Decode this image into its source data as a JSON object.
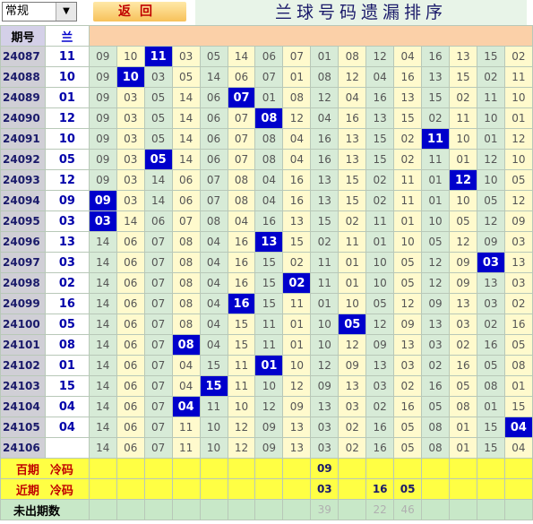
{
  "toolbar": {
    "select_value": "常规",
    "back_label": "返回",
    "title": "兰球号码遗漏排序"
  },
  "header": {
    "issue_label": "期号",
    "blue_label": "兰"
  },
  "rows": [
    {
      "issue": "24087",
      "blue": "11",
      "hit": 2,
      "cells": [
        "09",
        "10",
        "11",
        "03",
        "05",
        "14",
        "06",
        "07",
        "01",
        "08",
        "12",
        "04",
        "16",
        "13",
        "15",
        "02"
      ]
    },
    {
      "issue": "24088",
      "blue": "10",
      "hit": 1,
      "cells": [
        "09",
        "10",
        "03",
        "05",
        "14",
        "06",
        "07",
        "01",
        "08",
        "12",
        "04",
        "16",
        "13",
        "15",
        "02",
        "11"
      ]
    },
    {
      "issue": "24089",
      "blue": "01",
      "hit": 5,
      "cells": [
        "09",
        "03",
        "05",
        "14",
        "06",
        "07",
        "01",
        "08",
        "12",
        "04",
        "16",
        "13",
        "15",
        "02",
        "11",
        "10"
      ]
    },
    {
      "issue": "24090",
      "blue": "12",
      "hit": 6,
      "cells": [
        "09",
        "03",
        "05",
        "14",
        "06",
        "07",
        "08",
        "12",
        "04",
        "16",
        "13",
        "15",
        "02",
        "11",
        "10",
        "01"
      ]
    },
    {
      "issue": "24091",
      "blue": "10",
      "hit": 12,
      "cells": [
        "09",
        "03",
        "05",
        "14",
        "06",
        "07",
        "08",
        "04",
        "16",
        "13",
        "15",
        "02",
        "11",
        "10",
        "01",
        "12"
      ]
    },
    {
      "issue": "24092",
      "blue": "05",
      "hit": 2,
      "cells": [
        "09",
        "03",
        "05",
        "14",
        "06",
        "07",
        "08",
        "04",
        "16",
        "13",
        "15",
        "02",
        "11",
        "01",
        "12",
        "10"
      ]
    },
    {
      "issue": "24093",
      "blue": "12",
      "hit": 13,
      "cells": [
        "09",
        "03",
        "14",
        "06",
        "07",
        "08",
        "04",
        "16",
        "13",
        "15",
        "02",
        "11",
        "01",
        "12",
        "10",
        "05"
      ]
    },
    {
      "issue": "24094",
      "blue": "09",
      "hit": 0,
      "cells": [
        "09",
        "03",
        "14",
        "06",
        "07",
        "08",
        "04",
        "16",
        "13",
        "15",
        "02",
        "11",
        "01",
        "10",
        "05",
        "12"
      ]
    },
    {
      "issue": "24095",
      "blue": "03",
      "hit": 0,
      "cells": [
        "03",
        "14",
        "06",
        "07",
        "08",
        "04",
        "16",
        "13",
        "15",
        "02",
        "11",
        "01",
        "10",
        "05",
        "12",
        "09"
      ]
    },
    {
      "issue": "24096",
      "blue": "13",
      "hit": 6,
      "cells": [
        "14",
        "06",
        "07",
        "08",
        "04",
        "16",
        "13",
        "15",
        "02",
        "11",
        "01",
        "10",
        "05",
        "12",
        "09",
        "03"
      ]
    },
    {
      "issue": "24097",
      "blue": "03",
      "hit": 14,
      "cells": [
        "14",
        "06",
        "07",
        "08",
        "04",
        "16",
        "15",
        "02",
        "11",
        "01",
        "10",
        "05",
        "12",
        "09",
        "03",
        "13"
      ]
    },
    {
      "issue": "24098",
      "blue": "02",
      "hit": 7,
      "cells": [
        "14",
        "06",
        "07",
        "08",
        "04",
        "16",
        "15",
        "02",
        "11",
        "01",
        "10",
        "05",
        "12",
        "09",
        "13",
        "03"
      ]
    },
    {
      "issue": "24099",
      "blue": "16",
      "hit": 5,
      "cells": [
        "14",
        "06",
        "07",
        "08",
        "04",
        "16",
        "15",
        "11",
        "01",
        "10",
        "05",
        "12",
        "09",
        "13",
        "03",
        "02"
      ]
    },
    {
      "issue": "24100",
      "blue": "05",
      "hit": 9,
      "cells": [
        "14",
        "06",
        "07",
        "08",
        "04",
        "15",
        "11",
        "01",
        "10",
        "05",
        "12",
        "09",
        "13",
        "03",
        "02",
        "16"
      ]
    },
    {
      "issue": "24101",
      "blue": "08",
      "hit": 3,
      "cells": [
        "14",
        "06",
        "07",
        "08",
        "04",
        "15",
        "11",
        "01",
        "10",
        "12",
        "09",
        "13",
        "03",
        "02",
        "16",
        "05"
      ]
    },
    {
      "issue": "24102",
      "blue": "01",
      "hit": 6,
      "cells": [
        "14",
        "06",
        "07",
        "04",
        "15",
        "11",
        "01",
        "10",
        "12",
        "09",
        "13",
        "03",
        "02",
        "16",
        "05",
        "08"
      ]
    },
    {
      "issue": "24103",
      "blue": "15",
      "hit": 4,
      "cells": [
        "14",
        "06",
        "07",
        "04",
        "15",
        "11",
        "10",
        "12",
        "09",
        "13",
        "03",
        "02",
        "16",
        "05",
        "08",
        "01"
      ]
    },
    {
      "issue": "24104",
      "blue": "04",
      "hit": 3,
      "cells": [
        "14",
        "06",
        "07",
        "04",
        "11",
        "10",
        "12",
        "09",
        "13",
        "03",
        "02",
        "16",
        "05",
        "08",
        "01",
        "15"
      ]
    },
    {
      "issue": "24105",
      "blue": "04",
      "hit": 15,
      "cells": [
        "14",
        "06",
        "07",
        "11",
        "10",
        "12",
        "09",
        "13",
        "03",
        "02",
        "16",
        "05",
        "08",
        "01",
        "15",
        "04"
      ]
    },
    {
      "issue": "24106",
      "blue": "",
      "hit": -1,
      "cells": [
        "14",
        "06",
        "07",
        "11",
        "10",
        "12",
        "09",
        "13",
        "03",
        "02",
        "16",
        "05",
        "08",
        "01",
        "15",
        "04"
      ]
    }
  ],
  "footer": {
    "hundred_label_a": "百期",
    "hundred_label_b": "冷码",
    "hundred_values": [
      "",
      "",
      "",
      "",
      "",
      "",
      "",
      "",
      "09",
      "",
      "",
      "",
      "",
      "",
      "",
      ""
    ],
    "recent_label_a": "近期",
    "recent_label_b": "冷码",
    "recent_values": [
      "",
      "",
      "",
      "",
      "",
      "",
      "",
      "",
      "03",
      "",
      "16",
      "05",
      "",
      "",
      "",
      ""
    ],
    "unshown_label": "未出期数",
    "unshown_values": [
      "",
      "",
      "",
      "",
      "",
      "",
      "",
      "",
      "39",
      "",
      "22",
      "46",
      "",
      "",
      "",
      ""
    ]
  }
}
